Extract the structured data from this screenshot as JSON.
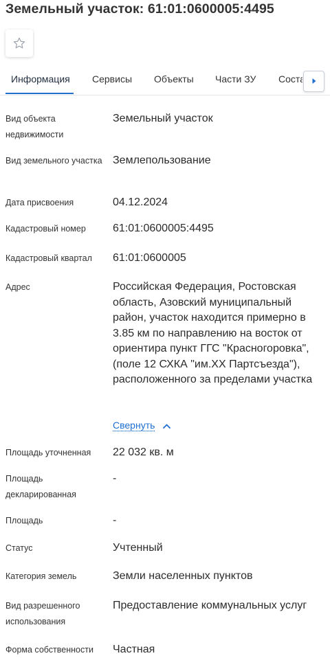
{
  "header": {
    "title": "Земельный участок: 61:01:0600005:4495"
  },
  "tabs": [
    {
      "label": "Информация"
    },
    {
      "label": "Сервисы"
    },
    {
      "label": "Объекты"
    },
    {
      "label": "Части ЗУ"
    },
    {
      "label": "Соста"
    }
  ],
  "info": {
    "object_type": {
      "label": "Вид объекта недвижимости",
      "value": "Земельный участок"
    },
    "land_type": {
      "label": "Вид земельного участка",
      "value": "Землепользование"
    },
    "assigned_date": {
      "label": "Дата присвоения",
      "value": "04.12.2024"
    },
    "cadastral_number": {
      "label": "Кадастровый номер",
      "value": "61:01:0600005:4495"
    },
    "cadastral_quarter": {
      "label": "Кадастровый квартал",
      "value": "61:01:0600005"
    },
    "address": {
      "label": "Адрес",
      "value": "Российская Федерация, Ростовская область, Азовский муниципальный район, участок находится примерно в 3.85 км по направлению на восток от ориентира пункт ГГС \"Красногоровка\", (поле 12 СХКА \"им.XX Партсъезда\"), расположенного за пределами участка",
      "collapse_label": "Свернуть"
    },
    "area_refined": {
      "label": "Площадь уточненная",
      "value": "22 032 кв. м"
    },
    "area_declared": {
      "label": "Площадь декларированная",
      "value": "-"
    },
    "area": {
      "label": "Площадь",
      "value": "-"
    },
    "status": {
      "label": "Статус",
      "value": "Учтенный"
    },
    "land_category": {
      "label": "Категория земель",
      "value": "Земли населенных пунктов"
    },
    "permitted_use": {
      "label": "Вид разрешенного использования",
      "value": "Предоставление коммунальных услуг"
    },
    "ownership": {
      "label": "Форма собственности",
      "value": "Частная"
    }
  },
  "colors": {
    "accent": "#1e6fd0",
    "text": "#2b2b2b",
    "border": "#e3e6ea"
  },
  "icons": {
    "favorite": "star-outline-icon",
    "scroll_right": "caret-right-icon",
    "collapse": "chevron-up-icon"
  }
}
